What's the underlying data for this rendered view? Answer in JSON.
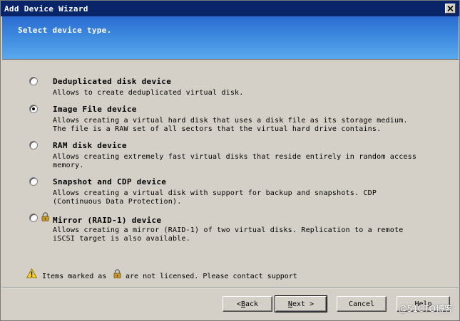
{
  "window": {
    "title": "Add Device Wizard"
  },
  "banner": {
    "text": "Select device type."
  },
  "options": [
    {
      "title": "Deduplicated disk device",
      "desc": "Allows to create deduplicated virtual disk.",
      "checked": false,
      "locked": false
    },
    {
      "title": "Image File device",
      "desc": "Allows creating a virtual hard disk that uses a disk file as its storage medium. The file is a RAW set of all sectors that the virtual hard drive contains.",
      "checked": true,
      "locked": false
    },
    {
      "title": "RAM disk device",
      "desc": "Allows creating extremely fast virtual disks that reside entirely in random access memory.",
      "checked": false,
      "locked": false
    },
    {
      "title": "Snapshot and CDP device",
      "desc": "Allows creating a virtual disk with support for backup and snapshots. CDP (Continuous Data Protection).",
      "checked": false,
      "locked": false
    },
    {
      "title": "Mirror (RAID-1) device",
      "desc": "Allows creating a mirror (RAID-1) of two virtual disks. Replication to a remote iSCSI target is also available.",
      "checked": false,
      "locked": true
    }
  ],
  "footer": {
    "note_before": "Items marked as",
    "note_after": "are not licensed. Please contact support"
  },
  "buttons": {
    "back_prefix": "< ",
    "back_hotkey": "B",
    "back_rest": "ack",
    "next_hotkey": "N",
    "next_rest": "ext >",
    "cancel": "Cancel",
    "help": "Help"
  },
  "watermark": "@51CTO博客",
  "icons": {
    "close": "close-icon",
    "lock": "lock-icon",
    "warning": "warning-icon"
  },
  "colors": {
    "titlebar": "#0a246a",
    "banner_top": "#2a6bd1",
    "banner_bottom": "#5aa8ec",
    "dialog_bg": "#d4d0c8"
  }
}
